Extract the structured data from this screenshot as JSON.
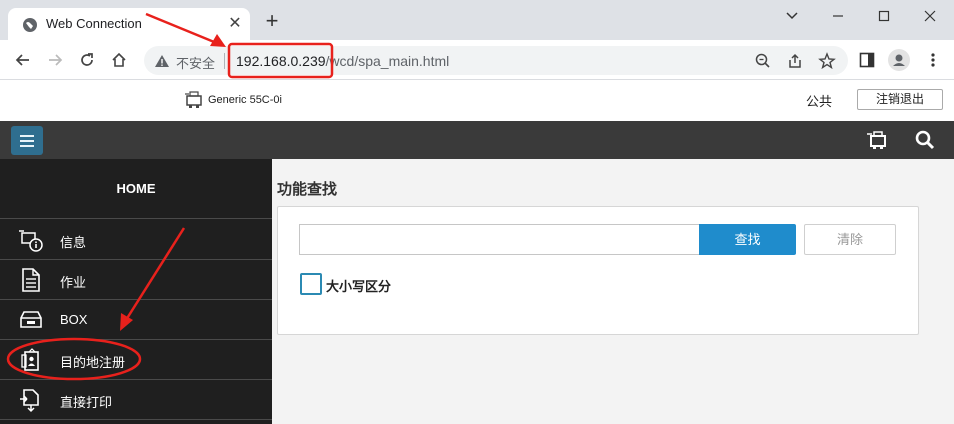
{
  "browser": {
    "tab_title": "Web Connection",
    "tab_close": "✕",
    "new_tab": "+",
    "insecure_label": "不安全",
    "url_host": "192.168.0.239",
    "url_path": "/wcd/spa_main.html"
  },
  "header": {
    "device_name": "Generic 55C-0i",
    "public_label": "公共",
    "logout_label": "注销退出"
  },
  "sidebar": {
    "home_label": "HOME",
    "items": [
      {
        "label": "信息",
        "icon": "info-printer-icon"
      },
      {
        "label": "作业",
        "icon": "document-icon"
      },
      {
        "label": "BOX",
        "icon": "box-tray-icon"
      },
      {
        "label": "目的地注册",
        "icon": "address-book-icon"
      },
      {
        "label": "直接打印",
        "icon": "direct-print-icon"
      }
    ]
  },
  "main": {
    "heading": "功能查找",
    "search_value": "",
    "search_placeholder": "",
    "search_button": "查找",
    "clear_button": "清除",
    "case_sensitive_label": "大小写区分",
    "case_sensitive_checked": false
  },
  "colors": {
    "dark_bar": "#3a3a3a",
    "sidebar_bg": "#1f1f1f",
    "menu_button": "#2f6e8f",
    "search_button": "#1f8ccc",
    "checkbox_border": "#2b8ab3",
    "annotation_red": "#e8211c"
  }
}
